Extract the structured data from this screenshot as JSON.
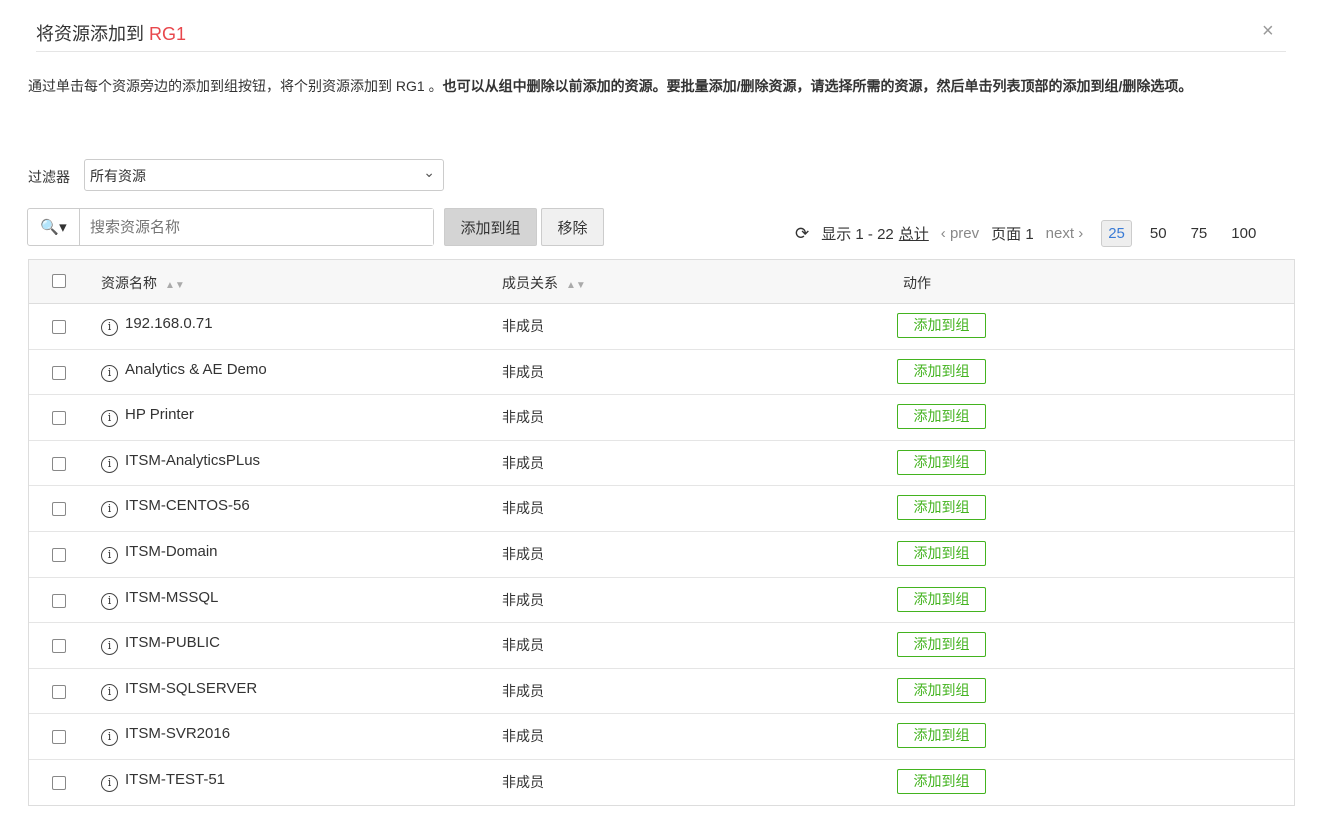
{
  "dialog": {
    "title_prefix": "将资源添加到 ",
    "title_group": "RG1",
    "close": "×"
  },
  "description": {
    "normal": "通过单击每个资源旁边的添加到组按钮，将个别资源添加到 RG1 。",
    "bold": "也可以从组中删除以前添加的资源。要批量添加/删除资源，请选择所需的资源，然后单击列表顶部的添加到组/删除选项。"
  },
  "filter": {
    "label": "过滤器",
    "value": "所有资源"
  },
  "search": {
    "placeholder": "搜索资源名称"
  },
  "toolbar": {
    "add": "添加到组",
    "remove": "移除"
  },
  "pager": {
    "showing": "显示 1 - 22",
    "total": "总计",
    "prev": "prev",
    "page": "页面 1",
    "next": "next",
    "sizes": [
      "25",
      "50",
      "75",
      "100"
    ],
    "selected_size": "25"
  },
  "table": {
    "headers": {
      "name": "资源名称",
      "membership": "成员关系",
      "action": "动作"
    },
    "rows": [
      {
        "name": "192.168.0.71",
        "membership": "非成员",
        "action": "添加到组"
      },
      {
        "name": "Analytics & AE Demo",
        "membership": "非成员",
        "action": "添加到组"
      },
      {
        "name": "HP Printer",
        "membership": "非成员",
        "action": "添加到组"
      },
      {
        "name": "ITSM-AnalyticsPLus",
        "membership": "非成员",
        "action": "添加到组"
      },
      {
        "name": "ITSM-CENTOS-56",
        "membership": "非成员",
        "action": "添加到组"
      },
      {
        "name": "ITSM-Domain",
        "membership": "非成员",
        "action": "添加到组"
      },
      {
        "name": "ITSM-MSSQL",
        "membership": "非成员",
        "action": "添加到组"
      },
      {
        "name": "ITSM-PUBLIC",
        "membership": "非成员",
        "action": "添加到组"
      },
      {
        "name": "ITSM-SQLSERVER",
        "membership": "非成员",
        "action": "添加到组"
      },
      {
        "name": "ITSM-SVR2016",
        "membership": "非成员",
        "action": "添加到组"
      },
      {
        "name": "ITSM-TEST-51",
        "membership": "非成员",
        "action": "添加到组"
      }
    ]
  }
}
